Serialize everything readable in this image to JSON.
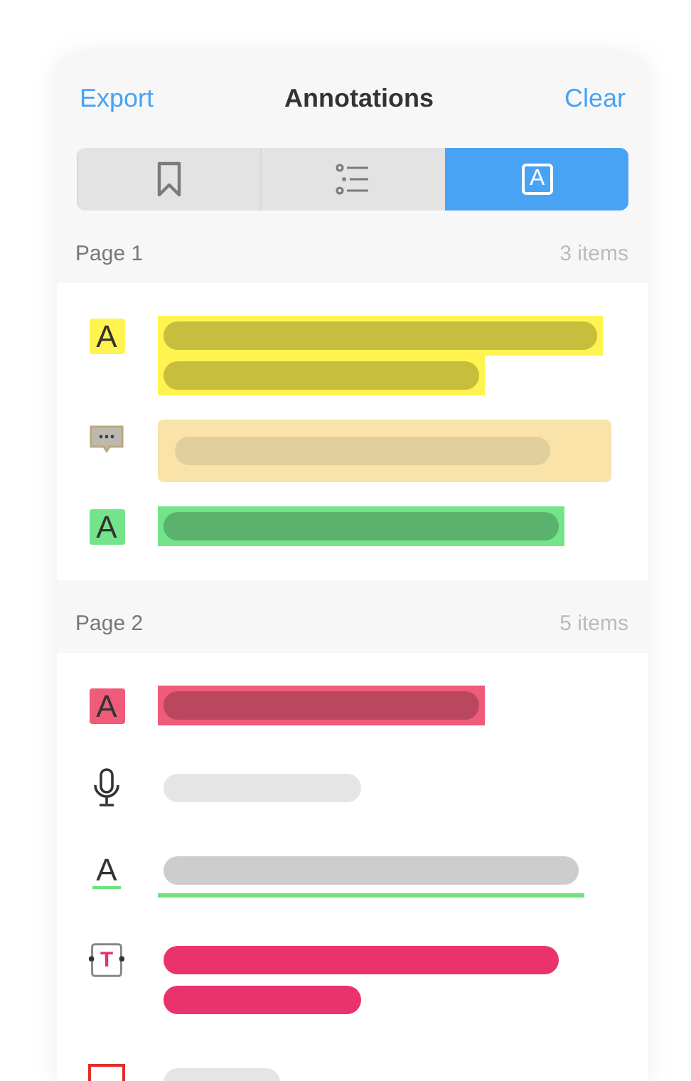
{
  "header": {
    "left_action": "Export",
    "title": "Annotations",
    "right_action": "Clear"
  },
  "tabs": [
    {
      "kind": "bookmarks",
      "selected": false
    },
    {
      "kind": "outline",
      "selected": false
    },
    {
      "kind": "annotations",
      "glyph": "A",
      "selected": true
    }
  ],
  "sections": [
    {
      "title": "Page 1",
      "count": "3 items",
      "items": [
        {
          "kind": "highlight",
          "glyph": "A",
          "color": "#fff350",
          "lines": [
            {
              "kind": "full"
            },
            {
              "kind": "medium"
            }
          ]
        },
        {
          "kind": "note",
          "color": "#f9e3a9",
          "lines": [
            {
              "kind": "note"
            }
          ]
        },
        {
          "kind": "highlight",
          "glyph": "A",
          "color": "#73e48a",
          "lines": [
            {
              "kind": "long"
            }
          ]
        }
      ]
    },
    {
      "title": "Page 2",
      "count": "5 items",
      "items": [
        {
          "kind": "highlight",
          "glyph": "A",
          "color": "#ef5b78",
          "lines": [
            {
              "kind": "medium"
            }
          ]
        },
        {
          "kind": "voice",
          "lines": [
            {
              "kind": "short"
            }
          ]
        },
        {
          "kind": "underline",
          "glyph": "A",
          "color": "#6de37f",
          "lines": [
            {
              "kind": "wide"
            }
          ]
        },
        {
          "kind": "textbox",
          "glyph": "T",
          "color": "#ea336c",
          "lines": [
            {
              "kind": "long"
            },
            {
              "kind": "short"
            }
          ]
        },
        {
          "kind": "shape",
          "color": "#e0302c",
          "lines": [
            {
              "kind": "tiny"
            }
          ]
        }
      ]
    }
  ]
}
